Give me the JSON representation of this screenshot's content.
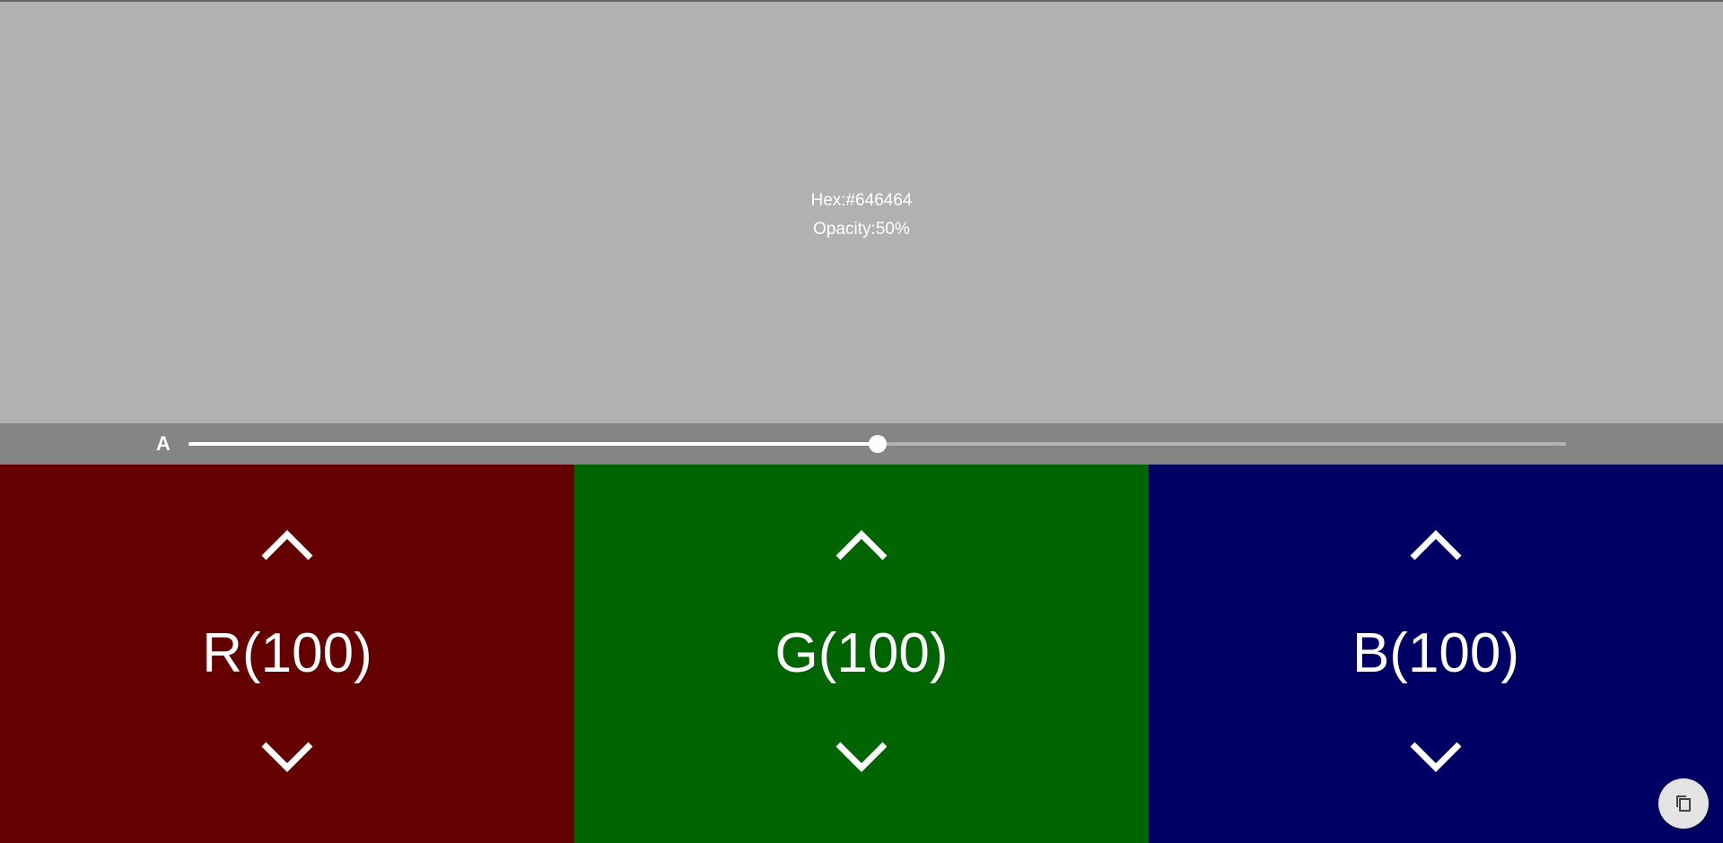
{
  "preview": {
    "hex_text": "Hex:#646464",
    "opacity_text": "Opacity:50%",
    "color": "#646464",
    "background": "#b1b1b1"
  },
  "alpha": {
    "label": "A",
    "value_fraction": 0.5
  },
  "channels": [
    {
      "label": "R(100)",
      "value": 100,
      "color": "#640000",
      "up_icon": "chevron-up-icon",
      "down_icon": "chevron-down-icon"
    },
    {
      "label": "G(100)",
      "value": 100,
      "color": "#006400",
      "up_icon": "chevron-up-icon",
      "down_icon": "chevron-down-icon"
    },
    {
      "label": "B(100)",
      "value": 100,
      "color": "#000064",
      "up_icon": "chevron-up-icon",
      "down_icon": "chevron-down-icon"
    }
  ],
  "copy_button": {
    "icon": "copy-icon"
  }
}
